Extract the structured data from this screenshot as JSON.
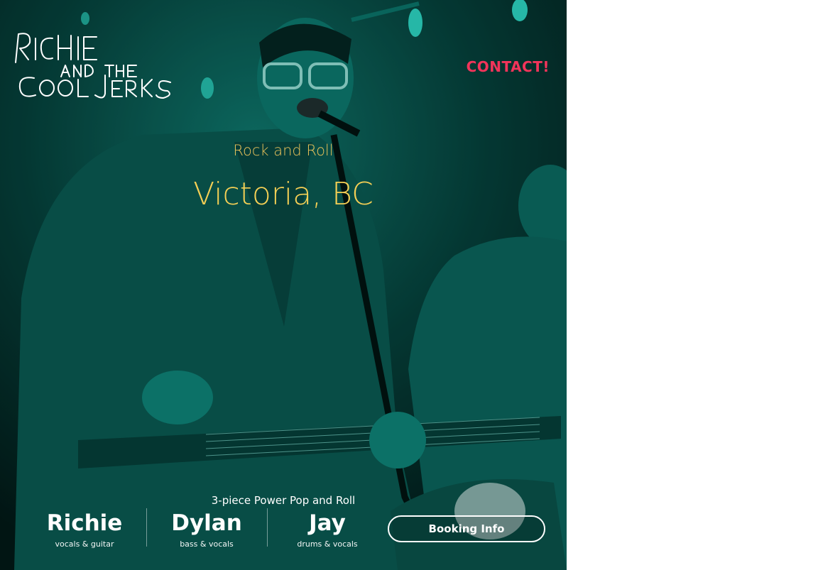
{
  "header": {
    "logo_text": "Richie and the Cool Jerks",
    "contact_label": "CONTACT!"
  },
  "hero": {
    "genre": "Rock and Roll",
    "city": "Victoria, BC",
    "tagline": "3-piece Power Pop and Roll",
    "tint_color": "#0a9c8c"
  },
  "members": [
    {
      "name": "Richie",
      "role": "vocals & guitar"
    },
    {
      "name": "Dylan",
      "role": "bass & vocals"
    },
    {
      "name": "Jay",
      "role": "drums & vocals"
    }
  ],
  "booking": {
    "label": "Booking Info"
  },
  "colors": {
    "accent_red": "#f2345a",
    "gold": "#f4cf55"
  }
}
